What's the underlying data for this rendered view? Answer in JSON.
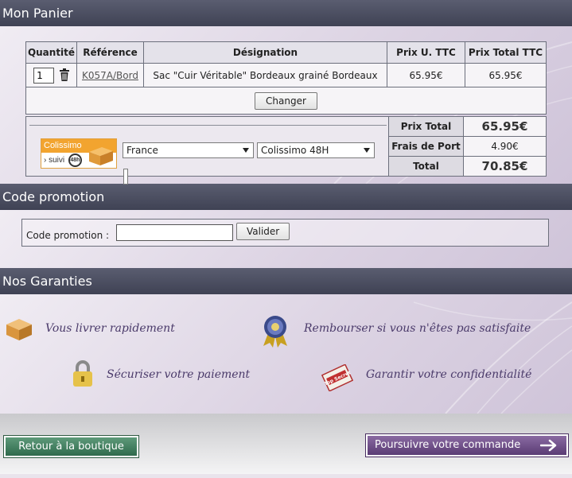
{
  "cart": {
    "title": "Mon Panier",
    "headers": {
      "quantity": "Quantité",
      "reference": "Référence",
      "designation": "Désignation",
      "unit_price": "Prix U. TTC",
      "total_price": "Prix Total TTC"
    },
    "item": {
      "quantity": "1",
      "reference": "K057A/Bord",
      "designation": "Sac \"Cuir Véritable\" Bordeaux grainé Bordeaux",
      "unit_price": "65.95€",
      "total_price": "65.95€"
    },
    "change_label": "Changer",
    "shipping": {
      "logo_top": "Colissimo",
      "logo_bottom": "› suivi",
      "logo_badge": "48h",
      "country": "France",
      "method": "Colissimo 48H"
    },
    "totals": {
      "subtotal_label": "Prix Total",
      "subtotal_value": "65.95€",
      "shipping_label": "Frais de Port",
      "shipping_value": "4.90€",
      "total_label": "Total",
      "total_value": "70.85€"
    }
  },
  "promo": {
    "title": "Code promotion",
    "label": "Code promotion :",
    "input_value": "",
    "validate_label": "Valider"
  },
  "guarantees": {
    "title": "Nos Garanties",
    "items": [
      {
        "icon": "package-icon",
        "text": "Vous livrer rapidement"
      },
      {
        "icon": "medal-icon",
        "text": "Rembourser si vous n'êtes pas satisfaite"
      },
      {
        "icon": "padlock-icon",
        "text": "Sécuriser votre paiement"
      },
      {
        "icon": "top-secret-stamp-icon",
        "text": "Garantir votre confidentialité"
      }
    ],
    "stamp_text": "Top Secret"
  },
  "footer": {
    "back_label": "Retour à la boutique",
    "next_label": "Poursuivre votre commande"
  },
  "colors": {
    "header_bg": "#45485a",
    "back_button": "#3f7a5c",
    "next_button": "#6a4c84",
    "accent_orange": "#f2a42f"
  }
}
